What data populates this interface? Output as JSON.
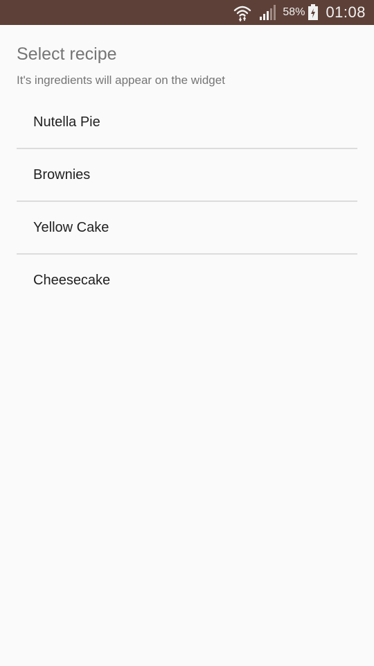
{
  "status_bar": {
    "battery_percent": "58%",
    "time": "01:08",
    "background_color": "#5d4037",
    "icons": [
      "wifi-icon",
      "signal-icon",
      "battery-charging-icon"
    ]
  },
  "dialog": {
    "title": "Select recipe",
    "subtitle": "It's ingredients will appear on the widget"
  },
  "recipes": [
    {
      "label": "Nutella Pie"
    },
    {
      "label": "Brownies"
    },
    {
      "label": "Yellow Cake"
    },
    {
      "label": "Cheesecake"
    }
  ]
}
